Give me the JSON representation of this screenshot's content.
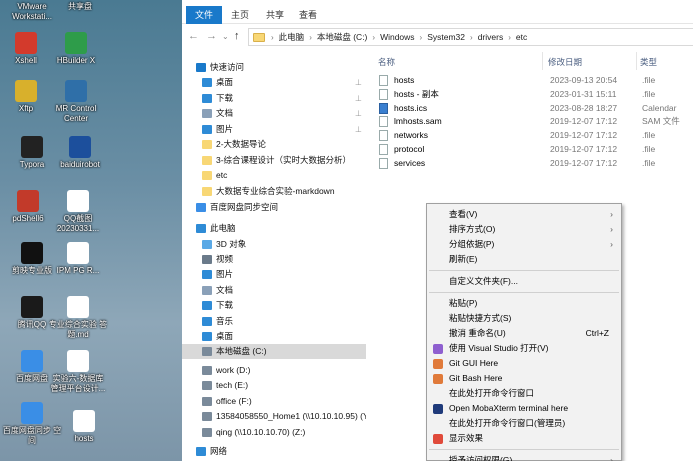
{
  "desktop": {
    "icons": [
      {
        "label": "VMware Workstati...",
        "color": "#6a8aa0"
      },
      {
        "label": "共享盘",
        "color": "#6a8aa0"
      },
      {
        "label": "Xshell",
        "color": "#d33a2c"
      },
      {
        "label": "HBuilder X",
        "color": "#2e9c4a"
      },
      {
        "label": "Xftp",
        "color": "#d8b02c"
      },
      {
        "label": "MR Control Center",
        "color": "#2f6fa8"
      },
      {
        "label": "Typora",
        "color": "#222222"
      },
      {
        "label": "baiduirobot",
        "color": "#1c4f9c"
      },
      {
        "label": "pdShell6",
        "color": "#c23a2a"
      },
      {
        "label": "QQ截图 20230331...",
        "color": "#ffffff"
      },
      {
        "label": "剪映专业版",
        "color": "#111111"
      },
      {
        "label": "IPM PG R...",
        "color": "#ffffff"
      },
      {
        "label": "腾讯QQ",
        "color": "#1a1a1a"
      },
      {
        "label": "专业综合实验 答题.md",
        "color": "#ffffff"
      },
      {
        "label": "百度网盘",
        "color": "#3a8ee6"
      },
      {
        "label": "实验六-数据库 管理平台设计...",
        "color": "#ffffff"
      },
      {
        "label": "百度网盘同步 空间",
        "color": "#3a8ee6"
      },
      {
        "label": "hosts",
        "color": "#ffffff"
      }
    ]
  },
  "ribbon": {
    "tabs": [
      "文件",
      "主页",
      "共享",
      "查看"
    ]
  },
  "address": {
    "crumbs": [
      "此电脑",
      "本地磁盘 (C:)",
      "Windows",
      "System32",
      "drivers",
      "etc"
    ]
  },
  "nav": {
    "items": [
      {
        "label": "快速访问",
        "color": "#1979ca"
      },
      {
        "label": "桌面",
        "color": "#2e8bd6",
        "pinned": true
      },
      {
        "label": "下载",
        "color": "#2e8bd6",
        "pinned": true
      },
      {
        "label": "文档",
        "color": "#8aa0b8",
        "pinned": true
      },
      {
        "label": "图片",
        "color": "#2e8bd6",
        "pinned": true
      },
      {
        "label": "2-大数据导论",
        "color": "#f8d775"
      },
      {
        "label": "3-综合课程设计（实时大数据分析）",
        "color": "#f8d775"
      },
      {
        "label": "etc",
        "color": "#f8d775"
      },
      {
        "label": "大数据专业综合实验-markdown",
        "color": "#f8d775"
      },
      {
        "label": "百度网盘同步空间",
        "color": "#3a8ee6"
      },
      {
        "label": "此电脑",
        "color": "#2e8bd6"
      },
      {
        "label": "3D 对象",
        "color": "#5aa9e6"
      },
      {
        "label": "视频",
        "color": "#6a7a8a"
      },
      {
        "label": "图片",
        "color": "#2e8bd6"
      },
      {
        "label": "文档",
        "color": "#8aa0b8"
      },
      {
        "label": "下载",
        "color": "#2e8bd6"
      },
      {
        "label": "音乐",
        "color": "#2e8bd6"
      },
      {
        "label": "桌面",
        "color": "#2e8bd6"
      },
      {
        "label": "本地磁盘 (C:)",
        "color": "#7a8a9a",
        "selected": true
      },
      {
        "label": "work (D:)",
        "color": "#7a8a9a"
      },
      {
        "label": "tech (E:)",
        "color": "#7a8a9a"
      },
      {
        "label": "office (F:)",
        "color": "#7a8a9a"
      },
      {
        "label": "13584058550_Home1 (\\\\10.10.10.95) (Y:)",
        "color": "#7a8a9a"
      },
      {
        "label": "qing (\\\\10.10.10.70) (Z:)",
        "color": "#7a8a9a"
      },
      {
        "label": "网络",
        "color": "#2e8bd6"
      }
    ]
  },
  "files": {
    "headers": {
      "name": "名称",
      "date": "修改日期",
      "type": "类型"
    },
    "rows": [
      {
        "name": "hosts",
        "date": "2023-09-13 20:54",
        "type": ".file"
      },
      {
        "name": "hosts - 副本",
        "date": "2023-01-31 15:11",
        "type": ".file"
      },
      {
        "name": "hosts.ics",
        "date": "2023-08-28 18:27",
        "type": "Calendar"
      },
      {
        "name": "lmhosts.sam",
        "date": "2019-12-07 17:12",
        "type": "SAM 文件"
      },
      {
        "name": "networks",
        "date": "2019-12-07 17:12",
        "type": ".file"
      },
      {
        "name": "protocol",
        "date": "2019-12-07 17:12",
        "type": ".file"
      },
      {
        "name": "services",
        "date": "2019-12-07 17:12",
        "type": ".file"
      }
    ]
  },
  "context_menu": {
    "items": [
      {
        "label": "查看(V)",
        "submenu": true
      },
      {
        "label": "排序方式(O)",
        "submenu": true
      },
      {
        "label": "分组依据(P)",
        "submenu": true
      },
      {
        "label": "刷新(E)"
      },
      {
        "sep": true
      },
      {
        "label": "自定义文件夹(F)..."
      },
      {
        "sep": true
      },
      {
        "label": "粘贴(P)"
      },
      {
        "label": "粘贴快捷方式(S)"
      },
      {
        "label": "撤消 重命名(U)",
        "shortcut": "Ctrl+Z"
      },
      {
        "label": "使用 Visual Studio 打开(V)",
        "icon": "#8e5fcf"
      },
      {
        "label": "Git GUI Here",
        "icon": "#e07a3a"
      },
      {
        "label": "Git Bash Here",
        "icon": "#e07a3a"
      },
      {
        "label": "在此处打开命令行窗口"
      },
      {
        "label": "Open MobaXterm terminal here",
        "icon": "#1f3a7a"
      },
      {
        "label": "在此处打开命令行窗口(管理员)"
      },
      {
        "label": "显示效果",
        "icon": "#e04a3a"
      },
      {
        "sep": true
      },
      {
        "label": "授予访问权限(G)",
        "submenu": true
      }
    ]
  }
}
